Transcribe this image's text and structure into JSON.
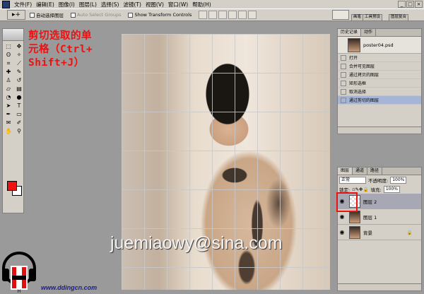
{
  "menubar": {
    "items": [
      "文件(F)",
      "编辑(E)",
      "图像(I)",
      "图层(L)",
      "选择(S)",
      "滤镜(T)",
      "视图(V)",
      "窗口(W)",
      "帮助(H)"
    ],
    "window_controls": [
      "_",
      "□",
      "×"
    ]
  },
  "options": {
    "tool_glyph": "▸+",
    "auto_select_layer": "自动选择图层",
    "auto_select_groups": "Auto Select Groups",
    "show_transform": "Show Transform Controls",
    "palette_tabs": [
      "画笔",
      "工具预设",
      "图层复合"
    ]
  },
  "caption": {
    "line1": "剪切选取的单",
    "line2": "元格（Ctrl+",
    "line3": "Shift+J）"
  },
  "watermark": "juemiaowy@sina.com",
  "history": {
    "tabs": [
      "历史记录",
      "动作"
    ],
    "snapshot": "poster04.psd",
    "items": [
      "打开",
      "合并可见图层",
      "通过拷贝的图层",
      "矩形选框",
      "取消选择",
      "通过剪切的图层"
    ]
  },
  "layers": {
    "tabs": [
      "图层",
      "通道",
      "路径"
    ],
    "blend_mode": "正常",
    "opacity_label": "不透明度:",
    "opacity_value": "100%",
    "lock_label": "锁定:",
    "fill_label": "填充:",
    "fill_value": "100%",
    "items": [
      {
        "name": "图层 2",
        "active": true
      },
      {
        "name": "图层 1",
        "active": false
      },
      {
        "name": "背景",
        "active": false
      }
    ]
  },
  "brand": {
    "url": "www.ddingcn.com",
    "logo_text": "H"
  }
}
